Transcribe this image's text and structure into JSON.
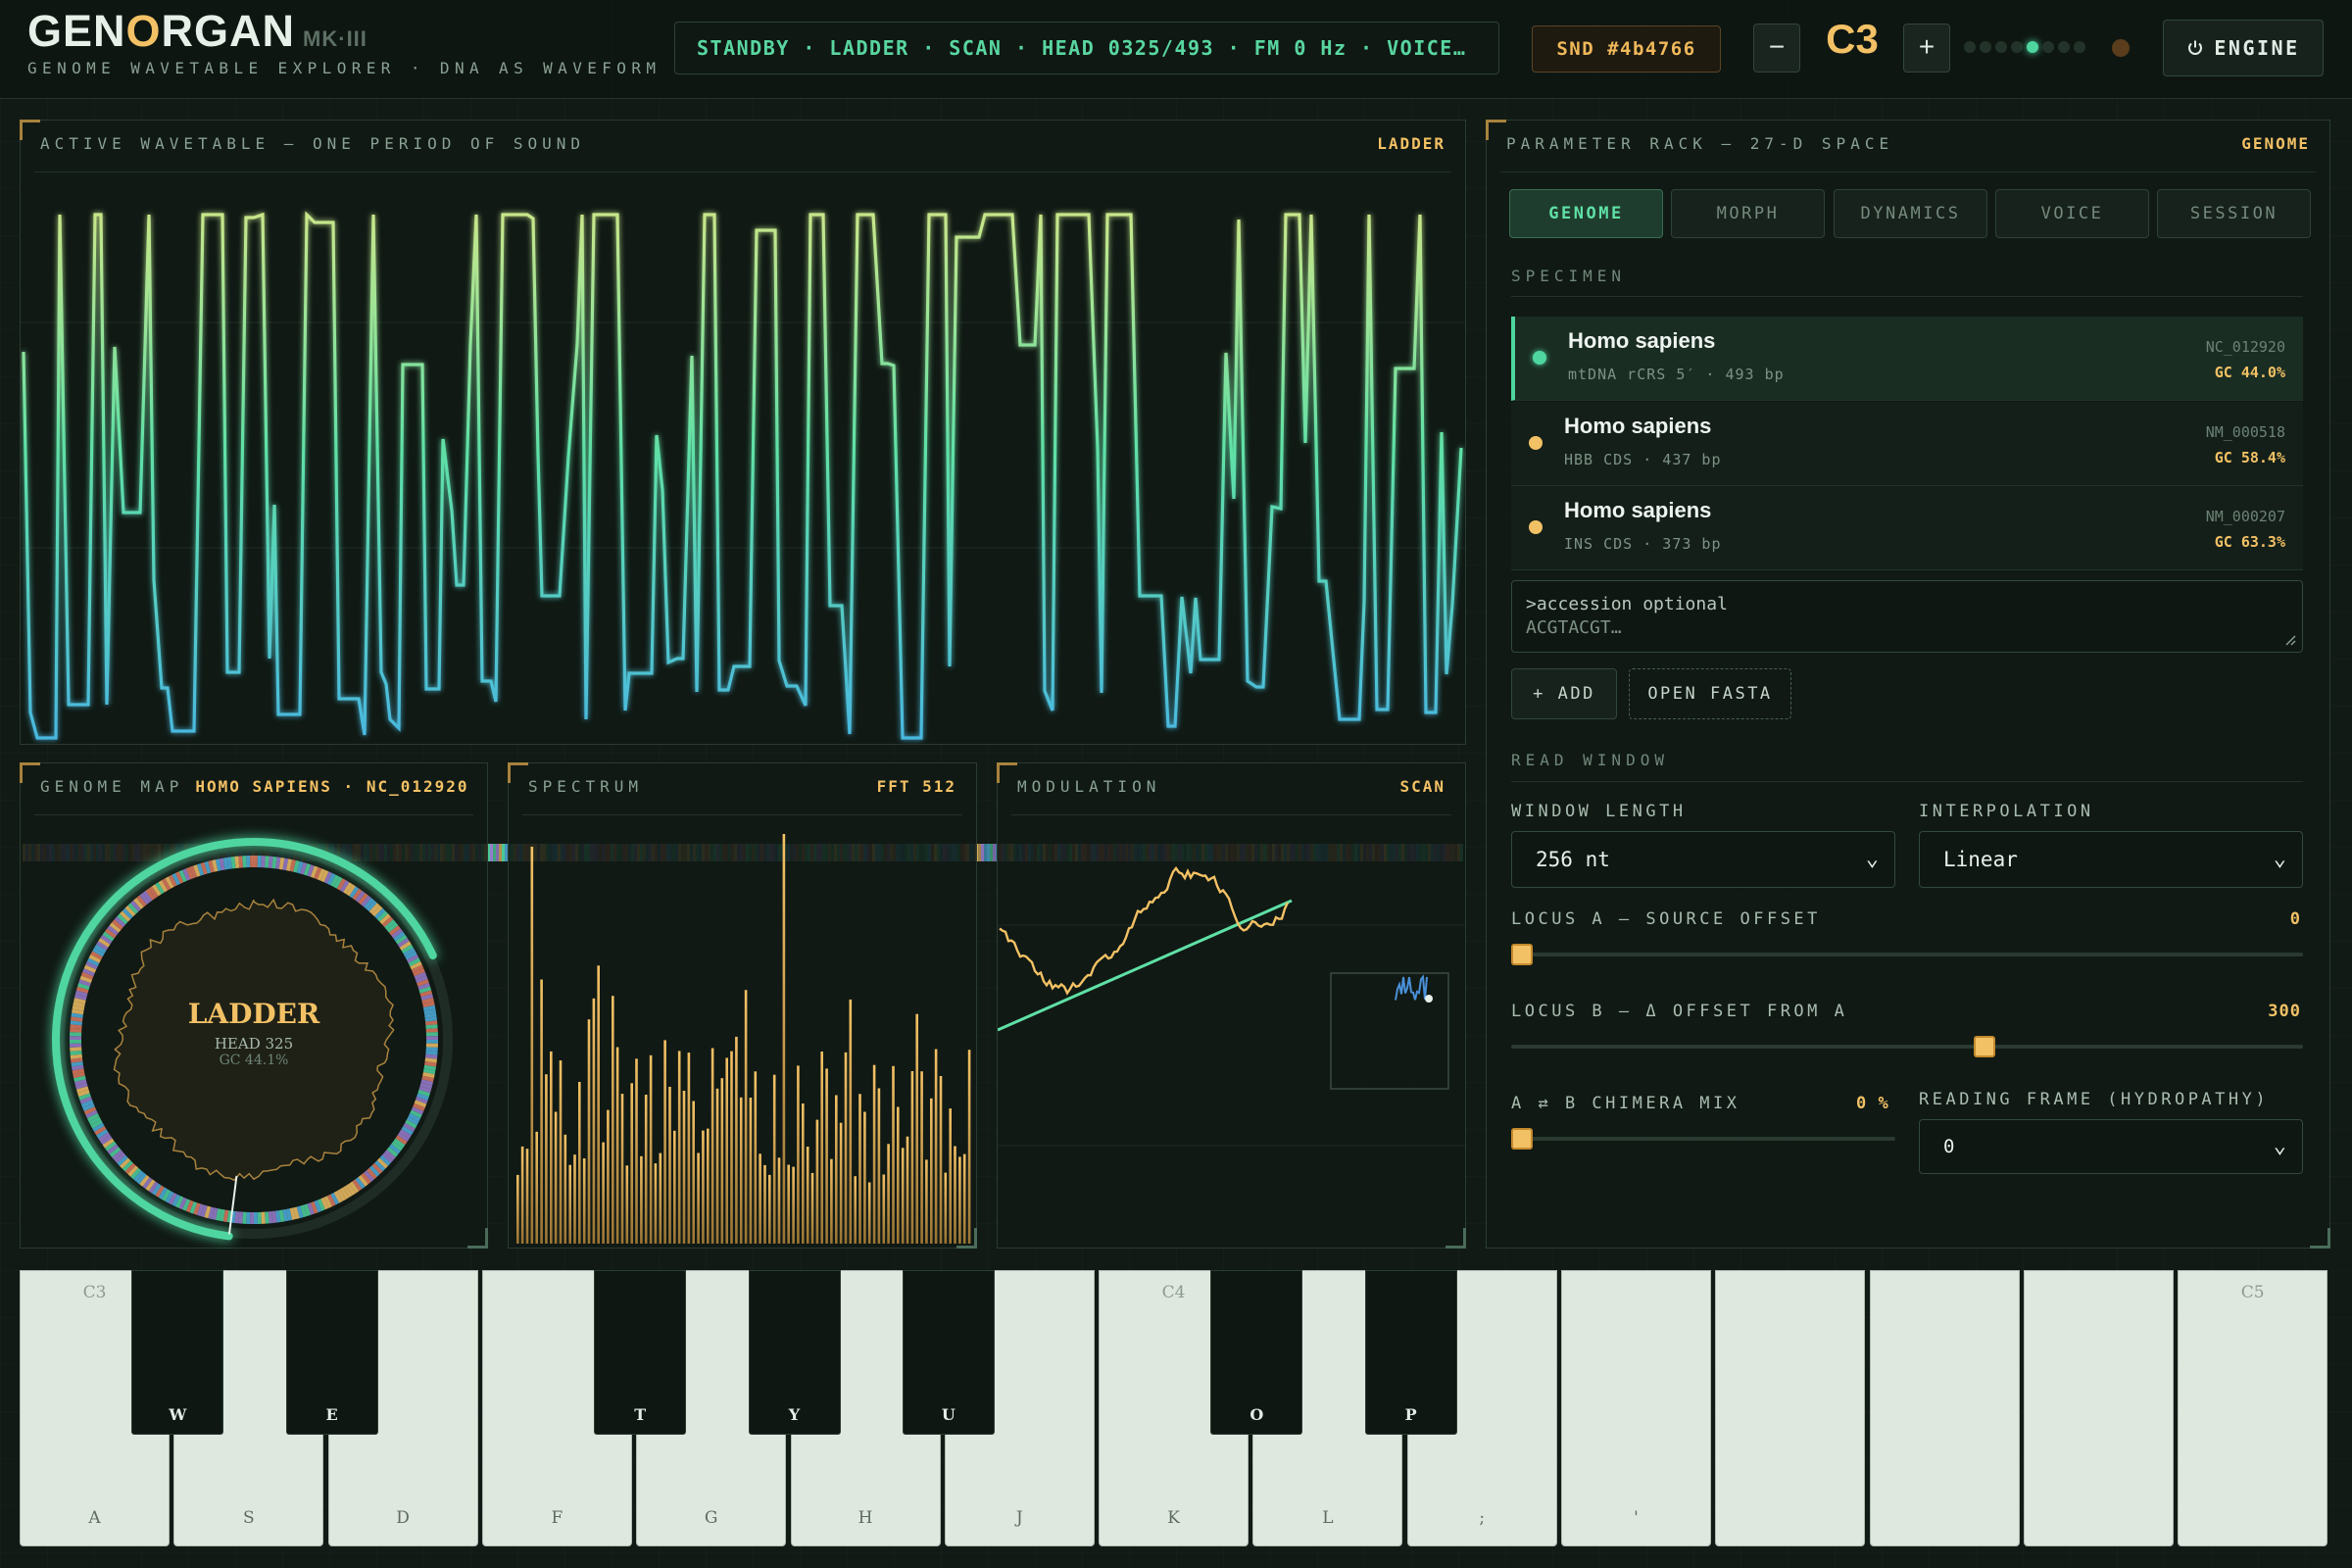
{
  "header": {
    "logo": {
      "part1": "GEN",
      "o": "O",
      "part2": "RGAN",
      "mk": "MK·III"
    },
    "tagline": "GENOME WAVETABLE EXPLORER · DNA AS WAVEFORM",
    "status": "STANDBY · LADDER · SCAN · HEAD 0325/493 · FM 0 Hz · VOICE…",
    "snd_tag": "SND #4b4766",
    "octave_down": "−",
    "octave_label": "C3",
    "octave_up": "+",
    "level_meter": {
      "dots": 8,
      "active_index": 4
    },
    "engine_button": "ENGINE",
    "engine_icon": "power-icon"
  },
  "wavetable": {
    "title": "ACTIVE WAVETABLE — ONE PERIOD OF SOUND",
    "tag": "LADDER"
  },
  "genome_map": {
    "title": "GENOME MAP",
    "tag": "HOMO SAPIENS · NC_012920",
    "mode": "LADDER",
    "head": "HEAD 325",
    "gc": "GC 44.1%",
    "head_fraction": 0.66
  },
  "spectrum": {
    "title": "SPECTRUM",
    "tag": "FFT 512"
  },
  "modulation": {
    "title": "MODULATION",
    "tag": "SCAN"
  },
  "rack": {
    "title": "PARAMETER RACK — 27-D SPACE",
    "tag": "GENOME",
    "tabs": [
      "GENOME",
      "MORPH",
      "DYNAMICS",
      "VOICE",
      "SESSION"
    ],
    "active_tab": 0,
    "specimen_label": "SPECIMEN",
    "specimens": [
      {
        "name": "Homo sapiens",
        "sub": "mtDNA rCRS 5′ · 493 bp",
        "acc": "NC_012920",
        "gc": "GC 44.0%",
        "color": "#4fd6a0"
      },
      {
        "name": "Homo sapiens",
        "sub": "HBB CDS · 437 bp",
        "acc": "NM_000518",
        "gc": "GC 58.4%",
        "color": "#f3c165"
      },
      {
        "name": "Homo sapiens",
        "sub": "INS CDS · 373 bp",
        "acc": "NM_000207",
        "gc": "GC 63.3%",
        "color": "#f3c165"
      }
    ],
    "accession_placeholder_1": ">accession optional",
    "accession_placeholder_2": "ACGTACGT…",
    "add_button": "+ ADD",
    "open_button": "OPEN FASTA",
    "read_window_label": "READ WINDOW",
    "window_length": {
      "label": "WINDOW LENGTH",
      "value": "256 nt"
    },
    "interpolation": {
      "label": "INTERPOLATION",
      "value": "Linear"
    },
    "locus_a": {
      "label": "LOCUS A — SOURCE OFFSET",
      "value": "0",
      "fraction": 0.0
    },
    "locus_b": {
      "label": "LOCUS B — Δ OFFSET FROM A",
      "value": "300",
      "fraction": 0.6
    },
    "chimera": {
      "label": "A ⇄ B CHIMERA MIX",
      "value": "0 %",
      "fraction": 0.0
    },
    "reading_frame": {
      "label": "READING FRAME (HYDROPATHY)",
      "value": "0"
    }
  },
  "keyboard": {
    "white_keys": [
      {
        "kb": "A",
        "note": "C3"
      },
      {
        "kb": "S",
        "note": ""
      },
      {
        "kb": "D",
        "note": ""
      },
      {
        "kb": "F",
        "note": ""
      },
      {
        "kb": "G",
        "note": ""
      },
      {
        "kb": "H",
        "note": ""
      },
      {
        "kb": "J",
        "note": ""
      },
      {
        "kb": "K",
        "note": "C4"
      },
      {
        "kb": "L",
        "note": ""
      },
      {
        "kb": ";",
        "note": ""
      },
      {
        "kb": "'",
        "note": ""
      },
      {
        "kb": "",
        "note": ""
      },
      {
        "kb": "",
        "note": ""
      },
      {
        "kb": "",
        "note": ""
      },
      {
        "kb": "",
        "note": "C5"
      }
    ],
    "black_keys": [
      {
        "kb": "W",
        "after": 0
      },
      {
        "kb": "E",
        "after": 1
      },
      {
        "kb": "T",
        "after": 3
      },
      {
        "kb": "Y",
        "after": 4
      },
      {
        "kb": "U",
        "after": 5
      },
      {
        "kb": "O",
        "after": 7
      },
      {
        "kb": "P",
        "after": 8
      }
    ]
  },
  "colors": {
    "accent_green": "#4fd6a0",
    "accent_amber": "#f3c165",
    "wave_top": "#c8e68a",
    "wave_mid": "#5fe0a6",
    "wave_bottom": "#4ab8e0"
  }
}
